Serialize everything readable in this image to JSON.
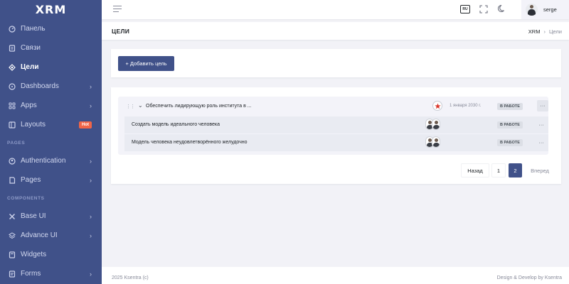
{
  "brand": {
    "logo_text": "XRM"
  },
  "sidebar": {
    "items": [
      {
        "label": "Панель",
        "icon": "dashboard-icon"
      },
      {
        "label": "Связи",
        "icon": "contacts-icon"
      },
      {
        "label": "Цели",
        "icon": "target-icon",
        "active": true
      },
      {
        "label": "Dashboards",
        "icon": "dashboards-icon",
        "has_children": true
      },
      {
        "label": "Apps",
        "icon": "apps-icon",
        "has_children": true
      },
      {
        "label": "Layouts",
        "icon": "layouts-icon",
        "badge": "Hot"
      }
    ],
    "section_pages": "PAGES",
    "pages_items": [
      {
        "label": "Authentication",
        "icon": "user-circle-icon"
      },
      {
        "label": "Pages",
        "icon": "pages-icon"
      }
    ],
    "section_components": "COMPONENTS",
    "component_items": [
      {
        "label": "Base UI",
        "icon": "pencil-ruler-icon"
      },
      {
        "label": "Advance UI",
        "icon": "stack-icon"
      },
      {
        "label": "Widgets",
        "icon": "widgets-icon"
      },
      {
        "label": "Forms",
        "icon": "forms-icon"
      }
    ]
  },
  "header": {
    "lang": "RU",
    "user_name": "serge"
  },
  "page": {
    "title": "ЦЕЛИ",
    "breadcrumb": [
      "XRM",
      "Цели"
    ]
  },
  "actions": {
    "add_goal_label": "+ Добавить цель"
  },
  "goals": {
    "parent": {
      "title": "Обеспечить лидирующую роль института в ...",
      "date": "1 января 2030 г.",
      "status": "В РАБОТЕ",
      "more": "···"
    },
    "children": [
      {
        "title": "Создать модель идеального человека",
        "status": "В РАБОТЕ",
        "more": "···"
      },
      {
        "title": "Модель человека неудовлетворённого желудочно",
        "status": "В РАБОТЕ",
        "more": "···"
      }
    ]
  },
  "pagination": {
    "prev": "Назад",
    "pages": [
      "1",
      "2"
    ],
    "current": "2",
    "next": "Вперед"
  },
  "footer": {
    "left": "2025 Ksentra (c)",
    "right": "Design & Develop by Ksentra"
  },
  "colors": {
    "primary": "#405189",
    "badge_hot": "#f06548",
    "background": "#f2f2f7"
  }
}
